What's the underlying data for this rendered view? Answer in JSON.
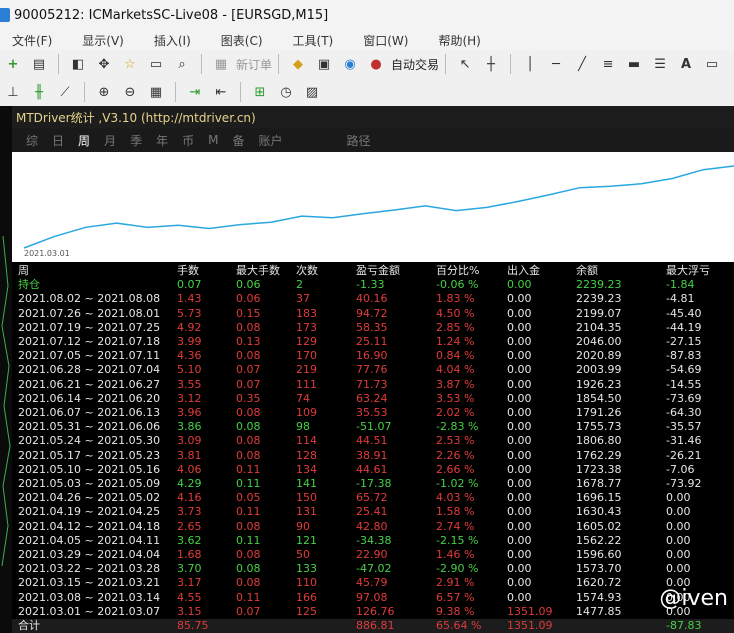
{
  "window_title": "90005212: ICMarketsSC-Live08 - [EURSGD,M15]",
  "menu": [
    "文件(F)",
    "显示(V)",
    "插入(I)",
    "图表(C)",
    "工具(T)",
    "窗口(W)",
    "帮助(H)"
  ],
  "toolbar": {
    "new_order_label": "新订单",
    "auto_trade_label": "自动交易",
    "text_tool": "A"
  },
  "panel": {
    "title": "MTDriver统计 ,V3.10 (http://mtdriver.cn)",
    "tabs": [
      "综",
      "日",
      "周",
      "月",
      "季",
      "年",
      "币",
      "M",
      "备",
      "账户",
      "路径"
    ],
    "chart_date": "2021.03.01"
  },
  "table": {
    "headers": [
      "周",
      "手数",
      "最大手数",
      "次数",
      "盈亏金额",
      "百分比%",
      "出入金",
      "余额",
      "最大浮亏"
    ],
    "hold": {
      "label": "持仓",
      "lots": "0.07",
      "max_lots": "0.06",
      "count": "2",
      "pnl": "-1.33",
      "pct": "-0.06 %",
      "deposit": "0.00",
      "balance": "2239.23",
      "max_dd": "-1.84"
    },
    "rows": [
      {
        "week": "2021.08.02 ~ 2021.08.08",
        "lots": "1.43",
        "max_lots": "0.06",
        "count": "37",
        "pnl": "40.16",
        "pct": "1.83 %",
        "deposit": "0.00",
        "balance": "2239.23",
        "max_dd": "-4.81",
        "color": "red"
      },
      {
        "week": "2021.07.26 ~ 2021.08.01",
        "lots": "5.73",
        "max_lots": "0.15",
        "count": "183",
        "pnl": "94.72",
        "pct": "4.50 %",
        "deposit": "0.00",
        "balance": "2199.07",
        "max_dd": "-45.40",
        "color": "red"
      },
      {
        "week": "2021.07.19 ~ 2021.07.25",
        "lots": "4.92",
        "max_lots": "0.08",
        "count": "173",
        "pnl": "58.35",
        "pct": "2.85 %",
        "deposit": "0.00",
        "balance": "2104.35",
        "max_dd": "-44.19",
        "color": "red"
      },
      {
        "week": "2021.07.12 ~ 2021.07.18",
        "lots": "3.99",
        "max_lots": "0.13",
        "count": "129",
        "pnl": "25.11",
        "pct": "1.24 %",
        "deposit": "0.00",
        "balance": "2046.00",
        "max_dd": "-27.15",
        "color": "red"
      },
      {
        "week": "2021.07.05 ~ 2021.07.11",
        "lots": "4.36",
        "max_lots": "0.08",
        "count": "170",
        "pnl": "16.90",
        "pct": "0.84 %",
        "deposit": "0.00",
        "balance": "2020.89",
        "max_dd": "-87.83",
        "color": "red"
      },
      {
        "week": "2021.06.28 ~ 2021.07.04",
        "lots": "5.10",
        "max_lots": "0.07",
        "count": "219",
        "pnl": "77.76",
        "pct": "4.04 %",
        "deposit": "0.00",
        "balance": "2003.99",
        "max_dd": "-54.69",
        "color": "red"
      },
      {
        "week": "2021.06.21 ~ 2021.06.27",
        "lots": "3.55",
        "max_lots": "0.07",
        "count": "111",
        "pnl": "71.73",
        "pct": "3.87 %",
        "deposit": "0.00",
        "balance": "1926.23",
        "max_dd": "-14.55",
        "color": "red"
      },
      {
        "week": "2021.06.14 ~ 2021.06.20",
        "lots": "3.12",
        "max_lots": "0.35",
        "count": "74",
        "pnl": "63.24",
        "pct": "3.53 %",
        "deposit": "0.00",
        "balance": "1854.50",
        "max_dd": "-73.69",
        "color": "red"
      },
      {
        "week": "2021.06.07 ~ 2021.06.13",
        "lots": "3.96",
        "max_lots": "0.08",
        "count": "109",
        "pnl": "35.53",
        "pct": "2.02 %",
        "deposit": "0.00",
        "balance": "1791.26",
        "max_dd": "-64.30",
        "color": "red"
      },
      {
        "week": "2021.05.31 ~ 2021.06.06",
        "lots": "3.86",
        "max_lots": "0.08",
        "count": "98",
        "pnl": "-51.07",
        "pct": "-2.83 %",
        "deposit": "0.00",
        "balance": "1755.73",
        "max_dd": "-35.57",
        "color": "green"
      },
      {
        "week": "2021.05.24 ~ 2021.05.30",
        "lots": "3.09",
        "max_lots": "0.08",
        "count": "114",
        "pnl": "44.51",
        "pct": "2.53 %",
        "deposit": "0.00",
        "balance": "1806.80",
        "max_dd": "-31.46",
        "color": "red"
      },
      {
        "week": "2021.05.17 ~ 2021.05.23",
        "lots": "3.81",
        "max_lots": "0.08",
        "count": "128",
        "pnl": "38.91",
        "pct": "2.26 %",
        "deposit": "0.00",
        "balance": "1762.29",
        "max_dd": "-26.21",
        "color": "red"
      },
      {
        "week": "2021.05.10 ~ 2021.05.16",
        "lots": "4.06",
        "max_lots": "0.11",
        "count": "134",
        "pnl": "44.61",
        "pct": "2.66 %",
        "deposit": "0.00",
        "balance": "1723.38",
        "max_dd": "-7.06",
        "color": "red"
      },
      {
        "week": "2021.05.03 ~ 2021.05.09",
        "lots": "4.29",
        "max_lots": "0.11",
        "count": "141",
        "pnl": "-17.38",
        "pct": "-1.02 %",
        "deposit": "0.00",
        "balance": "1678.77",
        "max_dd": "-73.92",
        "color": "green"
      },
      {
        "week": "2021.04.26 ~ 2021.05.02",
        "lots": "4.16",
        "max_lots": "0.05",
        "count": "150",
        "pnl": "65.72",
        "pct": "4.03 %",
        "deposit": "0.00",
        "balance": "1696.15",
        "max_dd": "0.00",
        "color": "red"
      },
      {
        "week": "2021.04.19 ~ 2021.04.25",
        "lots": "3.73",
        "max_lots": "0.11",
        "count": "131",
        "pnl": "25.41",
        "pct": "1.58 %",
        "deposit": "0.00",
        "balance": "1630.43",
        "max_dd": "0.00",
        "color": "red"
      },
      {
        "week": "2021.04.12 ~ 2021.04.18",
        "lots": "2.65",
        "max_lots": "0.08",
        "count": "90",
        "pnl": "42.80",
        "pct": "2.74 %",
        "deposit": "0.00",
        "balance": "1605.02",
        "max_dd": "0.00",
        "color": "red"
      },
      {
        "week": "2021.04.05 ~ 2021.04.11",
        "lots": "3.62",
        "max_lots": "0.11",
        "count": "121",
        "pnl": "-34.38",
        "pct": "-2.15 %",
        "deposit": "0.00",
        "balance": "1562.22",
        "max_dd": "0.00",
        "color": "green"
      },
      {
        "week": "2021.03.29 ~ 2021.04.04",
        "lots": "1.68",
        "max_lots": "0.08",
        "count": "50",
        "pnl": "22.90",
        "pct": "1.46 %",
        "deposit": "0.00",
        "balance": "1596.60",
        "max_dd": "0.00",
        "color": "red"
      },
      {
        "week": "2021.03.22 ~ 2021.03.28",
        "lots": "3.70",
        "max_lots": "0.08",
        "count": "133",
        "pnl": "-47.02",
        "pct": "-2.90 %",
        "deposit": "0.00",
        "balance": "1573.70",
        "max_dd": "0.00",
        "color": "green"
      },
      {
        "week": "2021.03.15 ~ 2021.03.21",
        "lots": "3.17",
        "max_lots": "0.08",
        "count": "110",
        "pnl": "45.79",
        "pct": "2.91 %",
        "deposit": "0.00",
        "balance": "1620.72",
        "max_dd": "0.00",
        "color": "red"
      },
      {
        "week": "2021.03.08 ~ 2021.03.14",
        "lots": "4.55",
        "max_lots": "0.11",
        "count": "166",
        "pnl": "97.08",
        "pct": "6.57 %",
        "deposit": "0.00",
        "balance": "1574.93",
        "max_dd": "0.00",
        "color": "red"
      },
      {
        "week": "2021.03.01 ~ 2021.03.07",
        "lots": "3.15",
        "max_lots": "0.07",
        "count": "125",
        "pnl": "126.76",
        "pct": "9.38 %",
        "deposit": "1351.09",
        "balance": "1477.85",
        "max_dd": "0.00",
        "color": "red"
      }
    ],
    "total": {
      "label": "合计",
      "lots": "85.75",
      "pnl": "886.81",
      "pct": "65.64 %",
      "deposit": "1351.09",
      "max_dd": "-87.83"
    }
  },
  "watermark": "@iven",
  "colors": {
    "profit": "#e03b3b",
    "loss": "#46d046",
    "line": "#2aa6e0"
  }
}
